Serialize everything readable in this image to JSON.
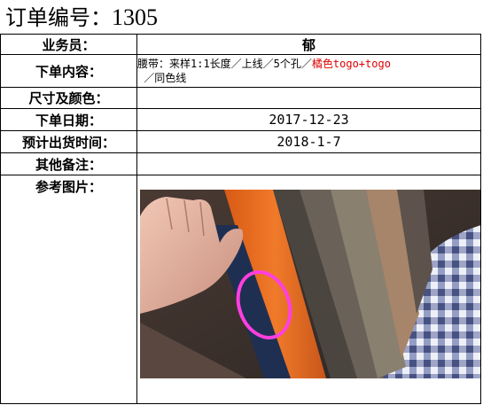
{
  "header": {
    "title_label": "订单编号：",
    "order_number": "1305"
  },
  "rows": {
    "salesperson": {
      "label": "业务员：",
      "value": "郁"
    },
    "order_content": {
      "label": "下单内容：",
      "text_before": "腰带：来样1:1长度／上线／5个孔／",
      "text_highlight": "橘色togo+togo",
      "text_after": "／同色线"
    },
    "size_color": {
      "label": "尺寸及颜色：",
      "value": ""
    },
    "order_date": {
      "label": "下单日期：",
      "value": "2017-12-23"
    },
    "ship_date": {
      "label": "预计出货时间：",
      "value": "2018-1-7"
    },
    "remarks": {
      "label": "其他备注：",
      "value": ""
    },
    "reference_image": {
      "label": "参考图片："
    }
  },
  "colors": {
    "highlight": "#e00000",
    "orange_leather": "#e46a1e",
    "navy_leather": "#1f2f52",
    "marker": "#ff3fe0"
  }
}
